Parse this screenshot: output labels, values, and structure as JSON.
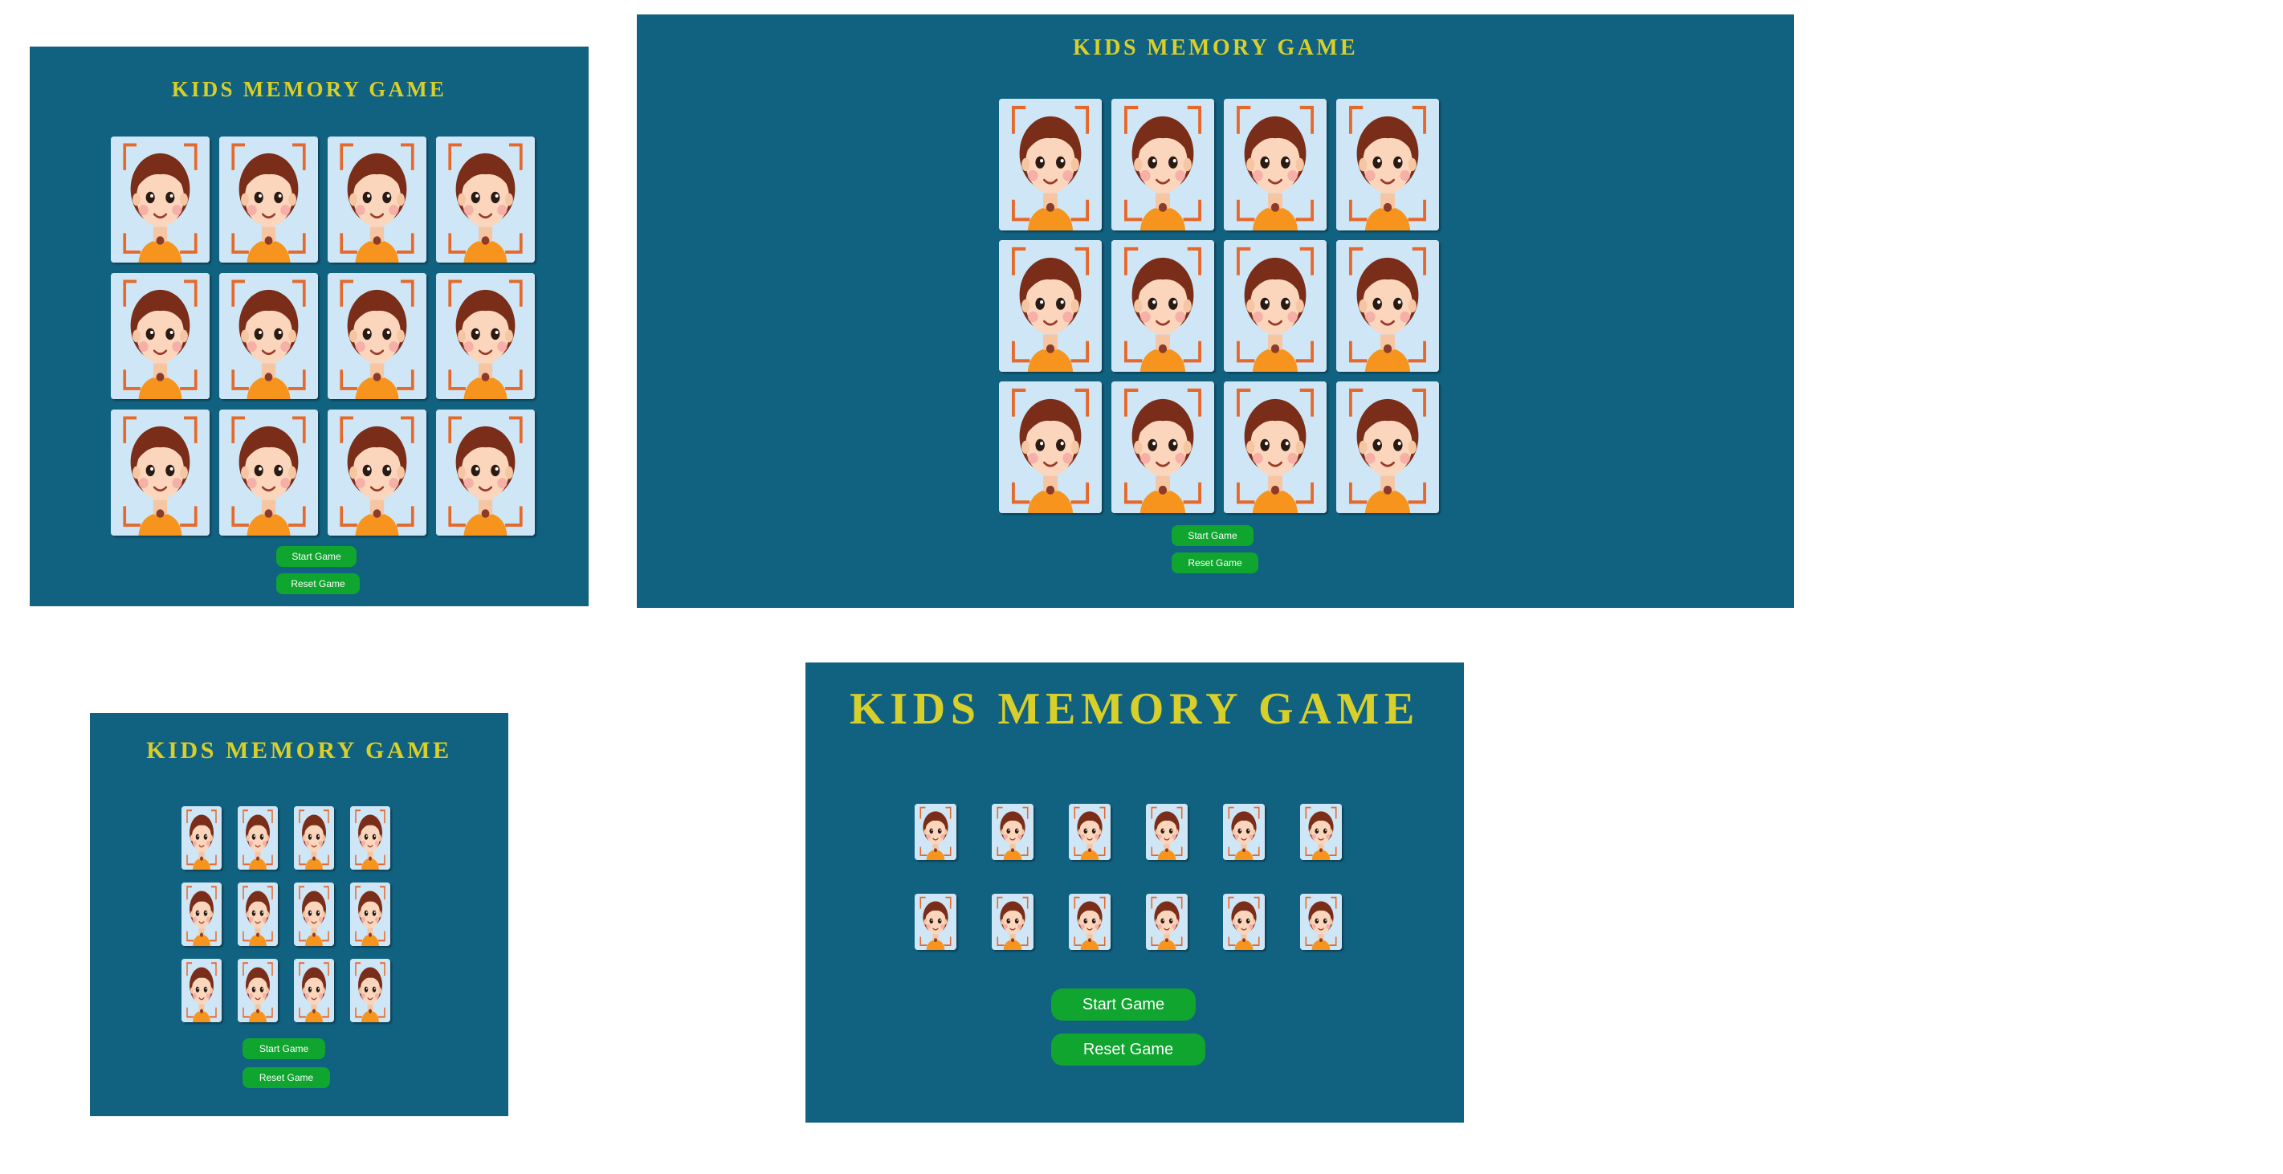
{
  "app": {
    "title": "KIDS MEMORY GAME",
    "start_label": "Start Game",
    "reset_label": "Reset Game"
  },
  "colors": {
    "panel": "#116280",
    "title": "#d8cf2a",
    "button": "#0fa52e",
    "card_face": "#cfe6f6"
  },
  "card": {
    "icon": "kid-face-icon",
    "count_per_board": 12
  }
}
